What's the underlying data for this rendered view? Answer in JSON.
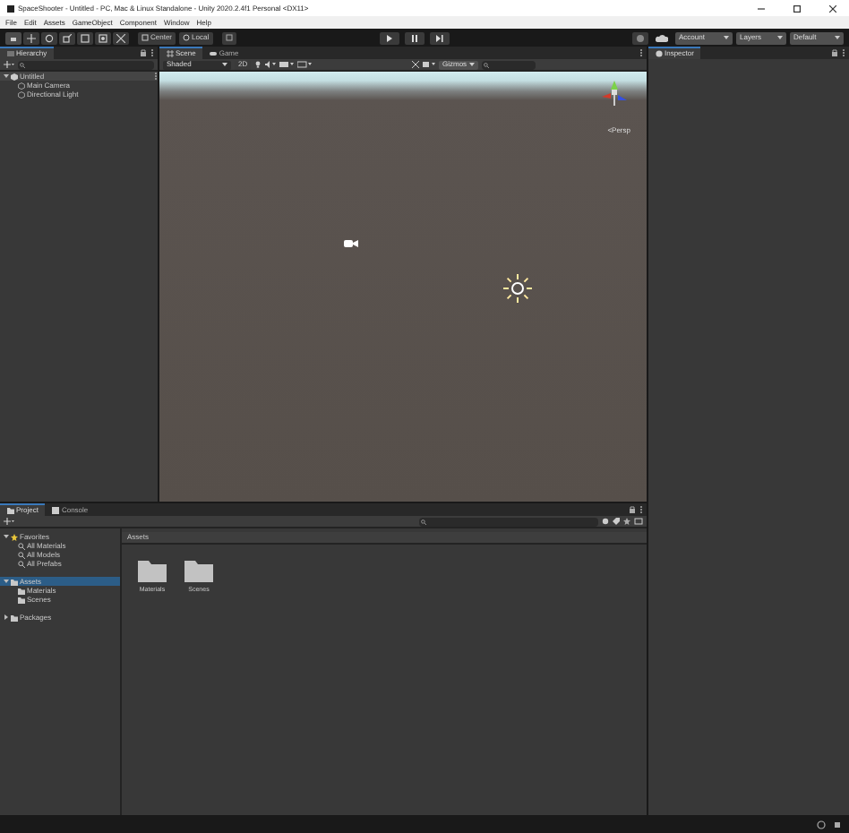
{
  "window": {
    "title": "SpaceShooter - Untitled - PC, Mac & Linux Standalone - Unity 2020.2.4f1 Personal <DX11>"
  },
  "menu": [
    "File",
    "Edit",
    "Assets",
    "GameObject",
    "Component",
    "Window",
    "Help"
  ],
  "toolbar": {
    "pivot": "Center",
    "space": "Local",
    "account": "Account",
    "layers": "Layers",
    "layout": "Default"
  },
  "hierarchy": {
    "title": "Hierarchy",
    "scene": {
      "label": "Untitled",
      "expanded": true,
      "children": [
        {
          "label": "Main Camera"
        },
        {
          "label": "Directional Light"
        }
      ]
    }
  },
  "scene_view": {
    "tabs": [
      {
        "label": "Scene",
        "selected": true
      },
      {
        "label": "Game",
        "selected": false
      }
    ],
    "shading": "Shaded",
    "mode_2d": "2D",
    "gizmos": "Gizmos",
    "projection": "<Persp"
  },
  "inspector": {
    "title": "Inspector"
  },
  "project": {
    "tabs": [
      {
        "label": "Project",
        "selected": true
      },
      {
        "label": "Console",
        "selected": false
      }
    ],
    "tree": [
      {
        "label": "Favorites",
        "kind": "favorites",
        "expanded": true,
        "selected": false,
        "children": [
          {
            "label": "All Materials",
            "kind": "search",
            "selected": false
          },
          {
            "label": "All Models",
            "kind": "search",
            "selected": false
          },
          {
            "label": "All Prefabs",
            "kind": "search",
            "selected": false
          }
        ]
      },
      {
        "label": "Assets",
        "kind": "folder",
        "expanded": true,
        "selected": true,
        "children": [
          {
            "label": "Materials",
            "kind": "folder",
            "selected": false
          },
          {
            "label": "Scenes",
            "kind": "folder",
            "selected": false
          }
        ]
      },
      {
        "label": "Packages",
        "kind": "folder",
        "expanded": false,
        "selected": false
      }
    ],
    "breadcrumb": "Assets",
    "items": [
      {
        "label": "Materials"
      },
      {
        "label": "Scenes"
      }
    ]
  }
}
